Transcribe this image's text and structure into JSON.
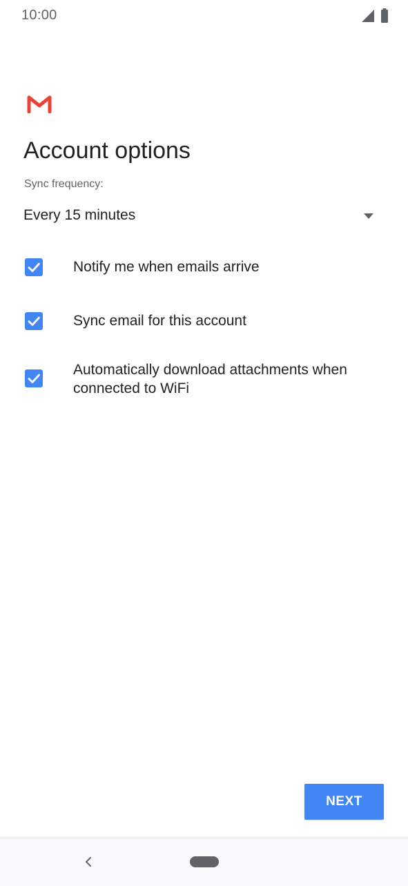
{
  "status_bar": {
    "time": "10:00",
    "icons": [
      "signal-icon",
      "battery-icon"
    ]
  },
  "header": {
    "logo": "gmail-logo",
    "title": "Account options"
  },
  "sync": {
    "label": "Sync frequency:",
    "selected_value": "Every 15 minutes"
  },
  "options": [
    {
      "label": "Notify me when emails arrive",
      "checked": true
    },
    {
      "label": "Sync email for this account",
      "checked": true
    },
    {
      "label": "Automatically download attachments when connected to WiFi",
      "checked": true
    }
  ],
  "actions": {
    "next_label": "NEXT"
  },
  "colors": {
    "accent": "#4285f4",
    "gmail_red": "#ea4335",
    "text_primary": "#202124",
    "text_secondary": "#5f6368"
  },
  "nav_bar": {
    "icons": [
      "back-icon",
      "home-pill"
    ]
  }
}
